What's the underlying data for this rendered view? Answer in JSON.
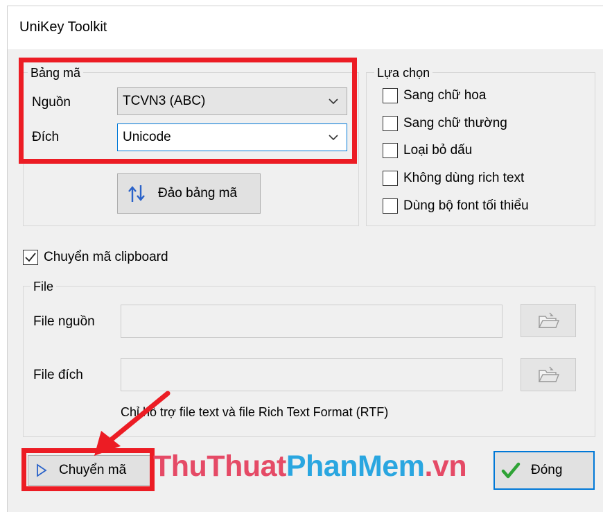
{
  "window": {
    "title": "UniKey Toolkit"
  },
  "encoding_table": {
    "legend": "Bảng mã",
    "source_label": "Nguồn",
    "source_value": "TCVN3 (ABC)",
    "target_label": "Đích",
    "target_value": "Unicode",
    "swap_button": "Đảo bảng mã"
  },
  "options": {
    "legend": "Lựa chọn",
    "items": [
      {
        "label": "Sang chữ hoa",
        "checked": false
      },
      {
        "label": "Sang chữ thường",
        "checked": false
      },
      {
        "label": "Loại bỏ dấu",
        "checked": false
      },
      {
        "label": "Không dùng rich text",
        "checked": false
      },
      {
        "label": "Dùng bộ font tối thiểu",
        "checked": false
      }
    ]
  },
  "clipboard": {
    "label": "Chuyển mã clipboard",
    "checked": true
  },
  "file": {
    "legend": "File",
    "source_label": "File nguồn",
    "target_label": "File đích",
    "note": "Chỉ hỗ trợ file text và file Rich Text Format (RTF)"
  },
  "buttons": {
    "convert": "Chuyển mã",
    "close": "Đóng"
  },
  "watermark": {
    "part1": "ThuThuat",
    "part2": "PhanMem",
    "part3": ".vn"
  },
  "colors": {
    "highlight_red": "#ec1c24",
    "focus_blue": "#0078d7",
    "window_bg": "#f0f0f0"
  }
}
